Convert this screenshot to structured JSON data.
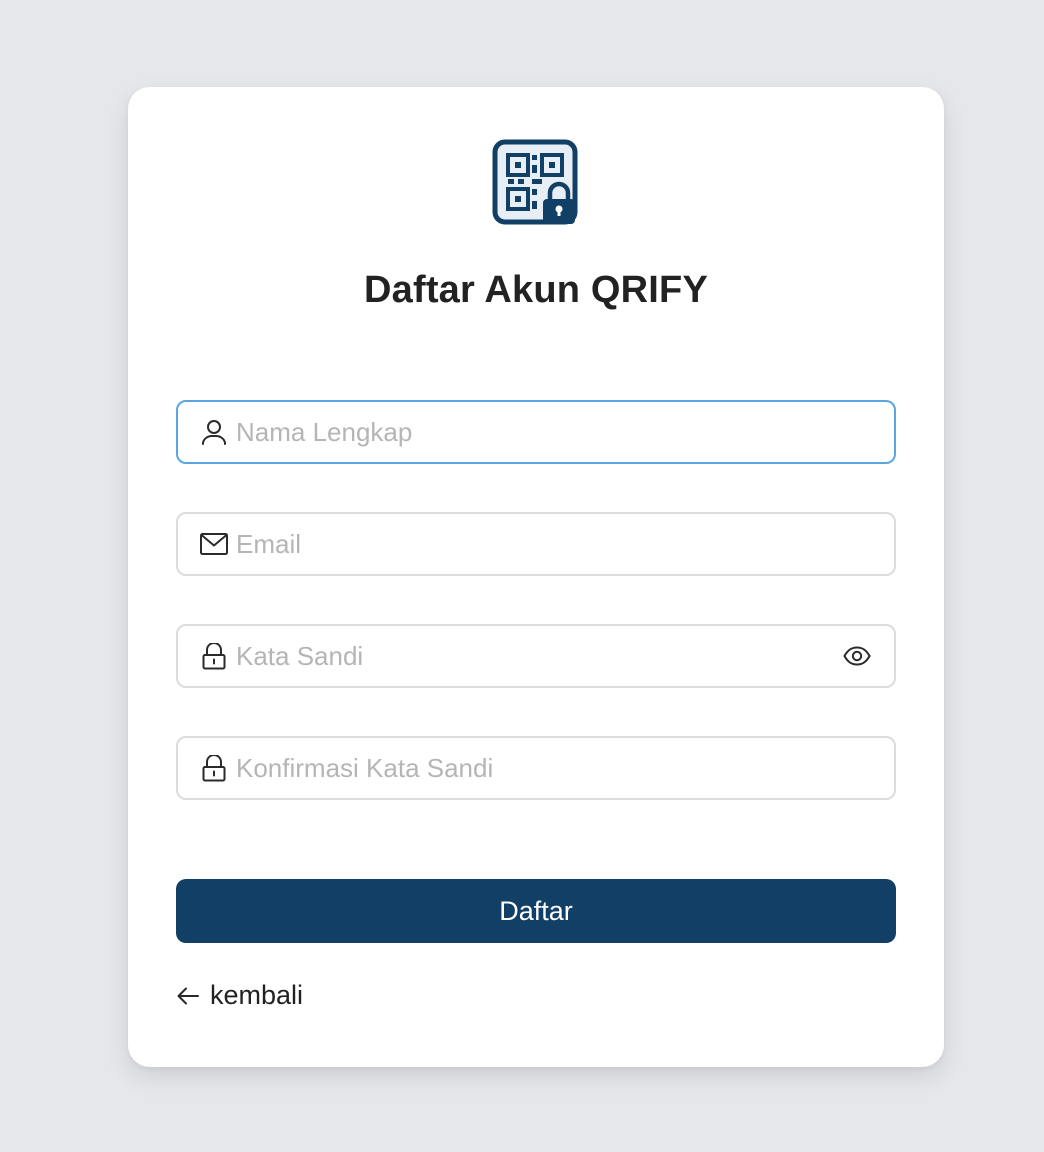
{
  "page": {
    "background": "#e6e7eb"
  },
  "logo": {
    "icon": "qr-code-lock-icon",
    "colors": {
      "frame": "#113f66",
      "fill": "#e8eef6"
    }
  },
  "form": {
    "title": "Daftar Akun QRIFY",
    "fields": [
      {
        "icon": "user-icon",
        "placeholder": "Nama Lengkap",
        "value": "",
        "focused": true
      },
      {
        "icon": "mail-icon",
        "placeholder": "Email",
        "value": ""
      },
      {
        "icon": "lock-icon",
        "placeholder": "Kata Sandi",
        "value": "",
        "toggle_icon": "eye-icon"
      },
      {
        "icon": "lock-icon",
        "placeholder": "Konfirmasi Kata Sandi",
        "value": ""
      }
    ],
    "submit_label": "Daftar",
    "back_label": "kembali",
    "back_icon": "arrow-left-icon"
  },
  "colors": {
    "primary": "#113f66",
    "focus_border": "#5aa6e3",
    "border": "#dcdcde",
    "placeholder": "#b5b5b8"
  }
}
